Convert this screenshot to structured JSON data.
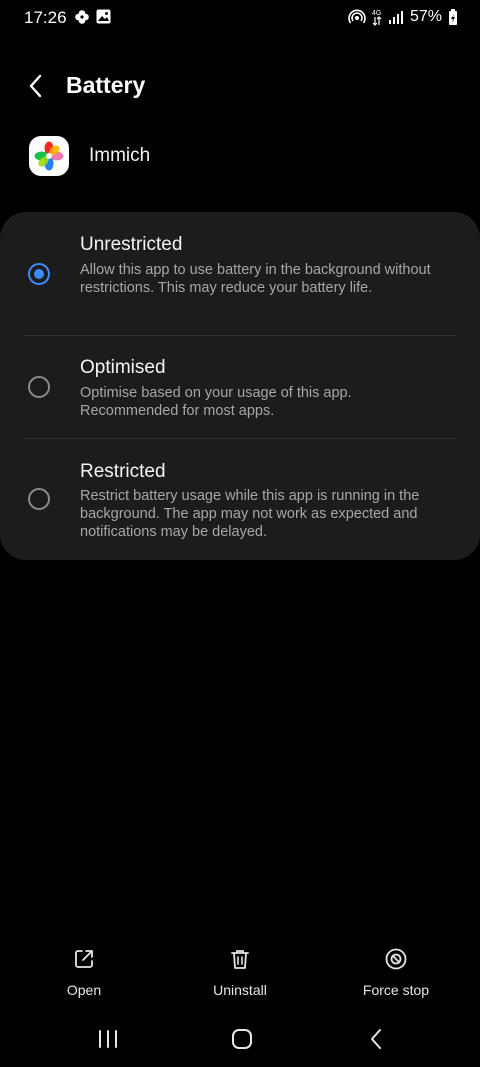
{
  "status_bar": {
    "time": "17:26",
    "battery_percent": "57%",
    "left_icons": [
      "pinwheel-icon",
      "image-icon"
    ],
    "right_icons": [
      "hotspot-icon",
      "data-icon",
      "signal-icon",
      "battery-icon"
    ]
  },
  "header": {
    "title": "Battery",
    "back_icon": "chevron-left-icon"
  },
  "app": {
    "name": "Immich"
  },
  "options": [
    {
      "title": "Unrestricted",
      "description": "Allow this app to use battery in the background without restrictions. This may reduce your battery life.",
      "selected": true
    },
    {
      "title": "Optimised",
      "description": "Optimise based on your usage of this app. Recommended for most apps.",
      "selected": false
    },
    {
      "title": "Restricted",
      "description": "Restrict battery usage while this app is running in the background. The app may not work as expected and notifications may be delayed.",
      "selected": false
    }
  ],
  "actions": {
    "open": "Open",
    "uninstall": "Uninstall",
    "force_stop": "Force stop"
  },
  "colors": {
    "background": "#000000",
    "card": "#1c1c1c",
    "accent": "#3e8bff",
    "secondary_text": "#a7a7a7"
  }
}
